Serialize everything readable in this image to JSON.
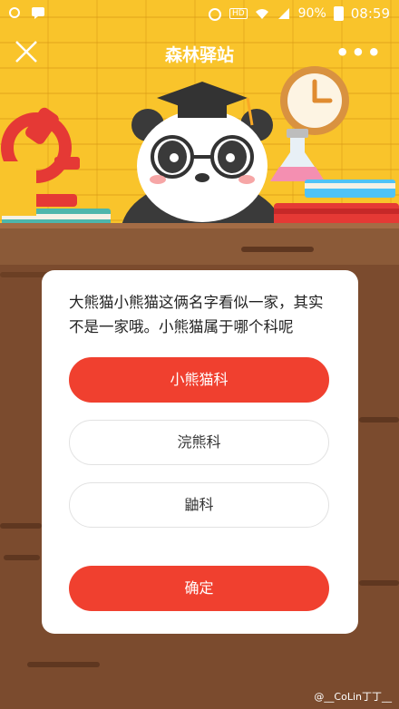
{
  "status_bar": {
    "battery": "90%",
    "time": "08:59",
    "hd_badge": "HD"
  },
  "header": {
    "title": "森林驿站"
  },
  "quiz": {
    "question": "大熊猫小熊猫这俩名字看似一家，其实不是一家哦。小熊猫属于哪个科呢",
    "options": [
      {
        "label": "小熊猫科",
        "selected": true
      },
      {
        "label": "浣熊科",
        "selected": false
      },
      {
        "label": "鼬科",
        "selected": false
      }
    ],
    "confirm_label": "确定"
  },
  "watermark": "@__CoLin丁丁__",
  "colors": {
    "wall": "#f9c42b",
    "accent_red": "#f0402f",
    "wood": "#7b4b2e"
  },
  "icons": [
    "close-icon",
    "more-icon",
    "panda-illustration",
    "microscope-icon",
    "clock-icon",
    "flask-icon",
    "books-icon"
  ]
}
